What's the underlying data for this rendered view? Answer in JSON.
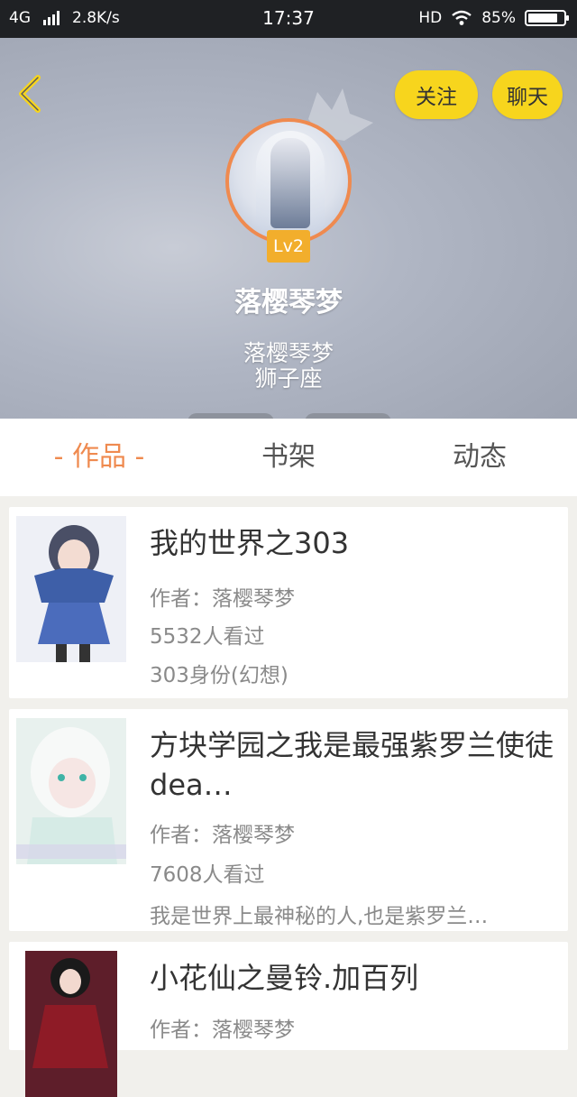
{
  "status_bar": {
    "network": "4G",
    "speed": "2.8K/s",
    "time": "17:37",
    "hd": "HD",
    "battery": "85%",
    "battery_level": 0.85
  },
  "header": {
    "follow_label": "关注",
    "chat_label": "聊天",
    "level": "Lv2",
    "name": "落樱琴梦",
    "signature_line1": "落樱琴梦",
    "signature_line2": "狮子座"
  },
  "tabs": [
    {
      "label": "- 作品 -",
      "active": true
    },
    {
      "label": "书架",
      "active": false
    },
    {
      "label": "动态",
      "active": false
    }
  ],
  "works": [
    {
      "title": "我的世界之303",
      "author": "作者：落樱琴梦",
      "views": "5532人看过",
      "desc": "303身份(幻想)"
    },
    {
      "title": "方块学园之我是最强紫罗兰使徒dea…",
      "author": "作者：落樱琴梦",
      "views": "7608人看过",
      "desc": "我是世界上最神秘的人,也是紫罗兰…"
    },
    {
      "title": "小花仙之曼铃.加百列",
      "author": "作者：落樱琴梦",
      "views": "",
      "desc": ""
    }
  ],
  "colors": {
    "accent": "#ef8a4f",
    "button_yellow": "#f7d51d",
    "level_badge": "#f2ae2c"
  }
}
